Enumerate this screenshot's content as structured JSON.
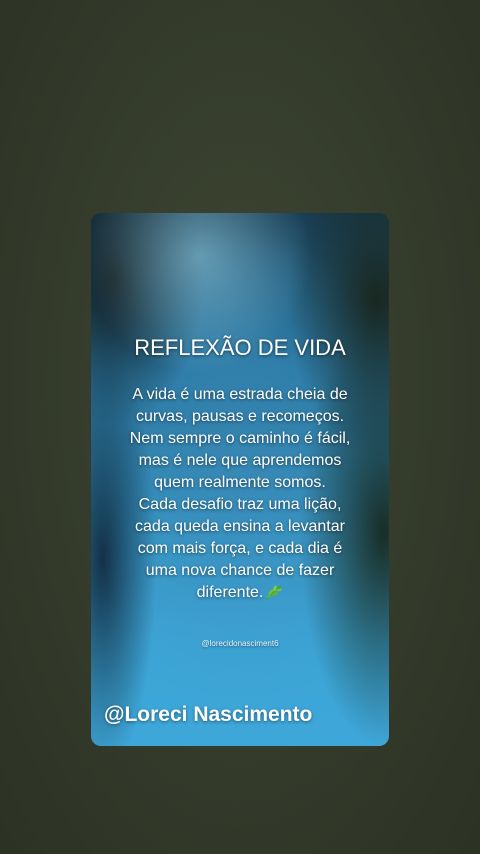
{
  "post": {
    "title": "REFLEXÃO DE VIDA",
    "paragraph1": "A vida é uma estrada cheia de curvas, pausas e recomeços. Nem sempre o caminho é fácil, mas é nele que aprendemos quem realmente somos.",
    "paragraph2": "Cada desafio traz uma lição, cada queda ensina a levantar com mais força, e cada dia é uma nova chance de fazer diferente.",
    "emoji_icon": "herb-leaf-icon",
    "small_handle": "@lorecidonasciment6",
    "signature": "@Loreci Nascimento"
  },
  "colors": {
    "page_background": "#363d2e",
    "water_blue": "#3aa2d2",
    "text": "#ffffff"
  }
}
